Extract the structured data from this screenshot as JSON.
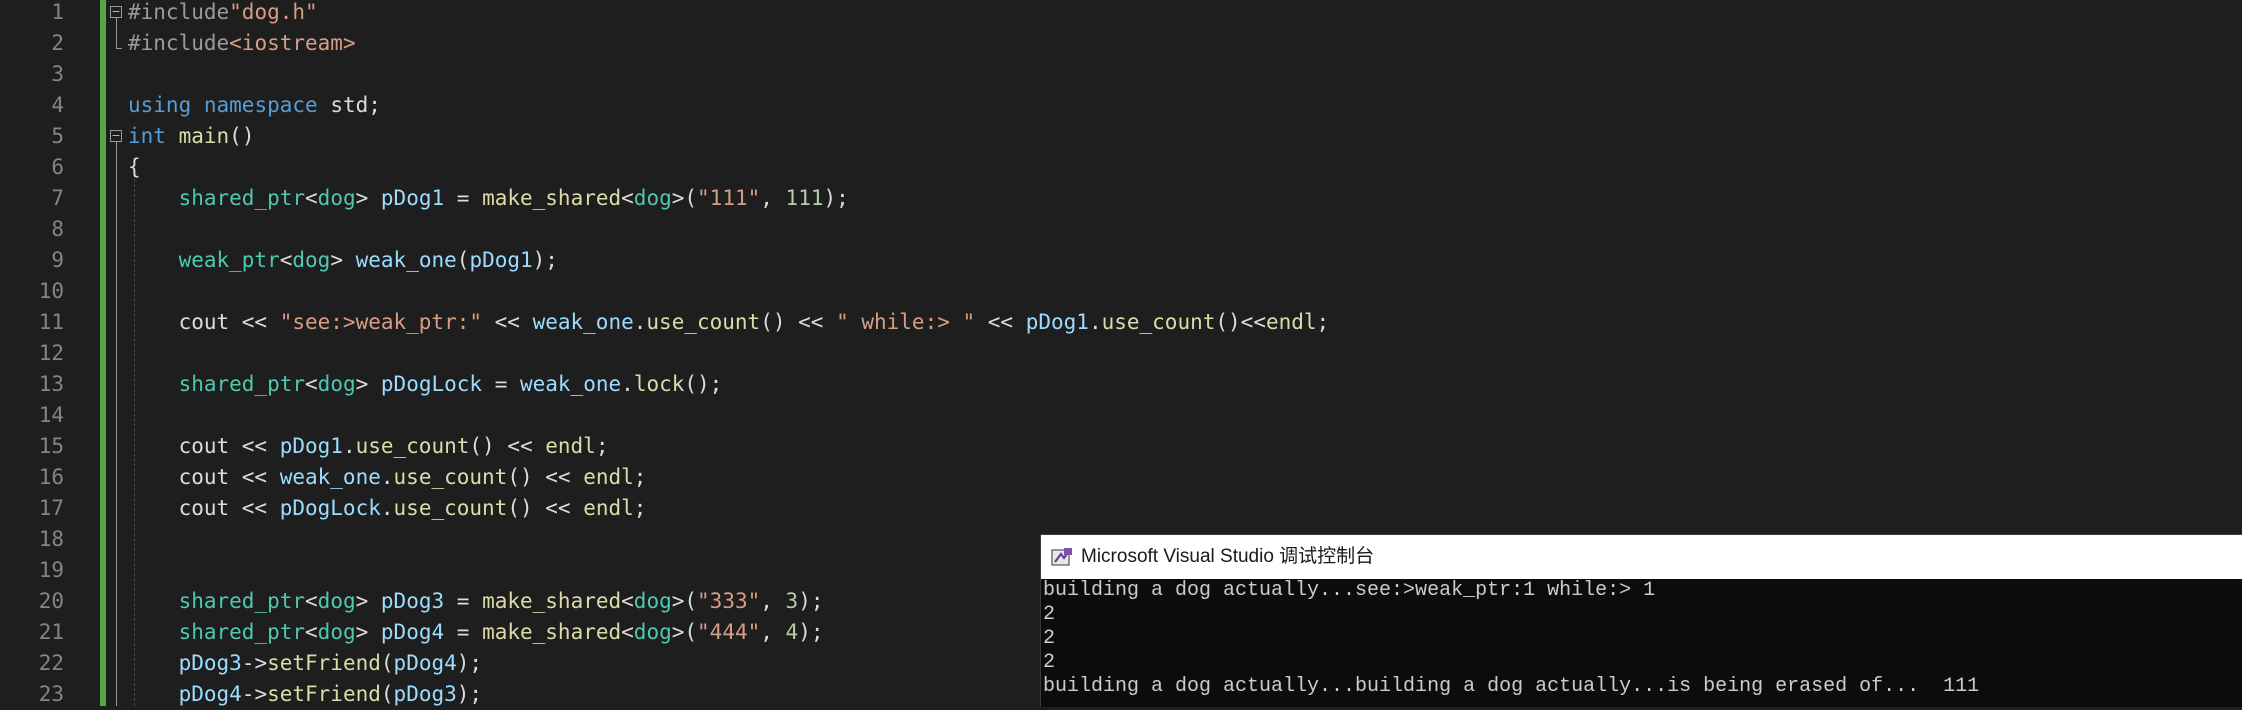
{
  "editor": {
    "line_numbers": [
      "1",
      "2",
      "3",
      "4",
      "5",
      "6",
      "7",
      "8",
      "9",
      "10",
      "11",
      "12",
      "13",
      "14",
      "15",
      "16",
      "17",
      "18",
      "19",
      "20",
      "21",
      "22",
      "23"
    ],
    "lines": [
      [
        {
          "t": "#include",
          "c": "pre"
        },
        {
          "t": "\"dog.h\"",
          "c": "str"
        }
      ],
      [
        {
          "t": "#include",
          "c": "pre"
        },
        {
          "t": "<iostream>",
          "c": "str"
        }
      ],
      [],
      [
        {
          "t": "using",
          "c": "kw"
        },
        {
          "t": " ",
          "c": "plain"
        },
        {
          "t": "namespace",
          "c": "kw"
        },
        {
          "t": " std;",
          "c": "plain"
        }
      ],
      [
        {
          "t": "int",
          "c": "kw"
        },
        {
          "t": " ",
          "c": "plain"
        },
        {
          "t": "main",
          "c": "fn"
        },
        {
          "t": "()",
          "c": "plain"
        }
      ],
      [
        {
          "t": "{",
          "c": "plain"
        }
      ],
      [
        {
          "t": "    ",
          "c": "plain"
        },
        {
          "t": "shared_ptr",
          "c": "type"
        },
        {
          "t": "<",
          "c": "plain"
        },
        {
          "t": "dog",
          "c": "type"
        },
        {
          "t": "> ",
          "c": "plain"
        },
        {
          "t": "pDog1",
          "c": "var"
        },
        {
          "t": " = ",
          "c": "plain"
        },
        {
          "t": "make_shared",
          "c": "fn"
        },
        {
          "t": "<",
          "c": "plain"
        },
        {
          "t": "dog",
          "c": "type"
        },
        {
          "t": ">(",
          "c": "plain"
        },
        {
          "t": "\"111\"",
          "c": "str"
        },
        {
          "t": ", ",
          "c": "plain"
        },
        {
          "t": "111",
          "c": "num"
        },
        {
          "t": ");",
          "c": "plain"
        }
      ],
      [],
      [
        {
          "t": "    ",
          "c": "plain"
        },
        {
          "t": "weak_ptr",
          "c": "type"
        },
        {
          "t": "<",
          "c": "plain"
        },
        {
          "t": "dog",
          "c": "type"
        },
        {
          "t": "> ",
          "c": "plain"
        },
        {
          "t": "weak_one",
          "c": "var"
        },
        {
          "t": "(",
          "c": "plain"
        },
        {
          "t": "pDog1",
          "c": "var"
        },
        {
          "t": ");",
          "c": "plain"
        }
      ],
      [],
      [
        {
          "t": "    cout << ",
          "c": "plain"
        },
        {
          "t": "\"see:>weak_ptr:\"",
          "c": "str"
        },
        {
          "t": " << ",
          "c": "plain"
        },
        {
          "t": "weak_one",
          "c": "var"
        },
        {
          "t": ".",
          "c": "plain"
        },
        {
          "t": "use_count",
          "c": "fn"
        },
        {
          "t": "() << ",
          "c": "plain"
        },
        {
          "t": "\" while:> \"",
          "c": "str"
        },
        {
          "t": " << ",
          "c": "plain"
        },
        {
          "t": "pDog1",
          "c": "var"
        },
        {
          "t": ".",
          "c": "plain"
        },
        {
          "t": "use_count",
          "c": "fn"
        },
        {
          "t": "()<<",
          "c": "plain"
        },
        {
          "t": "endl",
          "c": "fn"
        },
        {
          "t": ";",
          "c": "plain"
        }
      ],
      [],
      [
        {
          "t": "    ",
          "c": "plain"
        },
        {
          "t": "shared_ptr",
          "c": "type"
        },
        {
          "t": "<",
          "c": "plain"
        },
        {
          "t": "dog",
          "c": "type"
        },
        {
          "t": "> ",
          "c": "plain"
        },
        {
          "t": "pDogLock",
          "c": "var"
        },
        {
          "t": " = ",
          "c": "plain"
        },
        {
          "t": "weak_one",
          "c": "var"
        },
        {
          "t": ".",
          "c": "plain"
        },
        {
          "t": "lock",
          "c": "fn"
        },
        {
          "t": "();",
          "c": "plain"
        }
      ],
      [],
      [
        {
          "t": "    cout << ",
          "c": "plain"
        },
        {
          "t": "pDog1",
          "c": "var"
        },
        {
          "t": ".",
          "c": "plain"
        },
        {
          "t": "use_count",
          "c": "fn"
        },
        {
          "t": "() << ",
          "c": "plain"
        },
        {
          "t": "endl",
          "c": "fn"
        },
        {
          "t": ";",
          "c": "plain"
        }
      ],
      [
        {
          "t": "    cout << ",
          "c": "plain"
        },
        {
          "t": "weak_one",
          "c": "var"
        },
        {
          "t": ".",
          "c": "plain"
        },
        {
          "t": "use_count",
          "c": "fn"
        },
        {
          "t": "() << ",
          "c": "plain"
        },
        {
          "t": "endl",
          "c": "fn"
        },
        {
          "t": ";",
          "c": "plain"
        }
      ],
      [
        {
          "t": "    cout << ",
          "c": "plain"
        },
        {
          "t": "pDogLock",
          "c": "var"
        },
        {
          "t": ".",
          "c": "plain"
        },
        {
          "t": "use_count",
          "c": "fn"
        },
        {
          "t": "() << ",
          "c": "plain"
        },
        {
          "t": "endl",
          "c": "fn"
        },
        {
          "t": ";",
          "c": "plain"
        }
      ],
      [],
      [],
      [
        {
          "t": "    ",
          "c": "plain"
        },
        {
          "t": "shared_ptr",
          "c": "type"
        },
        {
          "t": "<",
          "c": "plain"
        },
        {
          "t": "dog",
          "c": "type"
        },
        {
          "t": "> ",
          "c": "plain"
        },
        {
          "t": "pDog3",
          "c": "var"
        },
        {
          "t": " = ",
          "c": "plain"
        },
        {
          "t": "make_shared",
          "c": "fn"
        },
        {
          "t": "<",
          "c": "plain"
        },
        {
          "t": "dog",
          "c": "type"
        },
        {
          "t": ">(",
          "c": "plain"
        },
        {
          "t": "\"333\"",
          "c": "str"
        },
        {
          "t": ", ",
          "c": "plain"
        },
        {
          "t": "3",
          "c": "num"
        },
        {
          "t": ");",
          "c": "plain"
        }
      ],
      [
        {
          "t": "    ",
          "c": "plain"
        },
        {
          "t": "shared_ptr",
          "c": "type"
        },
        {
          "t": "<",
          "c": "plain"
        },
        {
          "t": "dog",
          "c": "type"
        },
        {
          "t": "> ",
          "c": "plain"
        },
        {
          "t": "pDog4",
          "c": "var"
        },
        {
          "t": " = ",
          "c": "plain"
        },
        {
          "t": "make_shared",
          "c": "fn"
        },
        {
          "t": "<",
          "c": "plain"
        },
        {
          "t": "dog",
          "c": "type"
        },
        {
          "t": ">(",
          "c": "plain"
        },
        {
          "t": "\"444\"",
          "c": "str"
        },
        {
          "t": ", ",
          "c": "plain"
        },
        {
          "t": "4",
          "c": "num"
        },
        {
          "t": ");",
          "c": "plain"
        }
      ],
      [
        {
          "t": "    ",
          "c": "plain"
        },
        {
          "t": "pDog3",
          "c": "var"
        },
        {
          "t": "->",
          "c": "plain"
        },
        {
          "t": "setFriend",
          "c": "fn"
        },
        {
          "t": "(",
          "c": "plain"
        },
        {
          "t": "pDog4",
          "c": "var"
        },
        {
          "t": ");",
          "c": "plain"
        }
      ],
      [
        {
          "t": "    ",
          "c": "plain"
        },
        {
          "t": "pDog4",
          "c": "var"
        },
        {
          "t": "->",
          "c": "plain"
        },
        {
          "t": "setFriend",
          "c": "fn"
        },
        {
          "t": "(",
          "c": "plain"
        },
        {
          "t": "pDog3",
          "c": "var"
        },
        {
          "t": ");",
          "c": "plain"
        }
      ]
    ],
    "fold_icons": [
      "minus-box-icon",
      "minus-box-icon"
    ],
    "fold_symbol": "−"
  },
  "console": {
    "icon": "visual-studio-console-icon",
    "title": "Microsoft Visual Studio 调试控制台",
    "lines": [
      "building a dog actually...see:>weak_ptr:1 while:> 1",
      "2",
      "2",
      "2",
      "building a dog actually...building a dog actually...is being erased of...  111"
    ]
  }
}
